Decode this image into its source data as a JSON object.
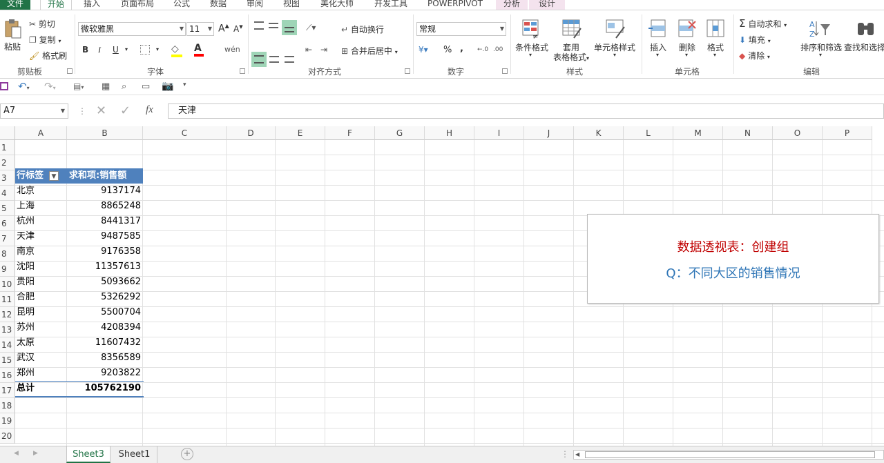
{
  "ribbon_tabs": [
    "文件",
    "开始",
    "插入",
    "页面布局",
    "公式",
    "数据",
    "审阅",
    "视图",
    "美化大师",
    "开发工具",
    "POWERPIVOT",
    "分析",
    "设计"
  ],
  "clipboard": {
    "paste": "粘贴",
    "cut": "剪切",
    "copy": "复制",
    "format_painter": "格式刷",
    "group": "剪贴板"
  },
  "font": {
    "name": "微软雅黑",
    "size": "11",
    "bold": "B",
    "italic": "I",
    "underline": "U",
    "group": "字体"
  },
  "alignment": {
    "wrap": "自动换行",
    "merge": "合并后居中",
    "group": "对齐方式"
  },
  "number": {
    "format": "常规",
    "percent": "%",
    "comma": ",",
    "group": "数字"
  },
  "styles": {
    "conditional": "条件格式",
    "table_format_1": "套用",
    "table_format_2": "表格格式",
    "cell_styles": "单元格样式",
    "group": "样式"
  },
  "cells": {
    "insert": "插入",
    "delete": "删除",
    "format": "格式",
    "group": "单元格"
  },
  "editing": {
    "autosum": "自动求和",
    "fill": "填充",
    "clear": "清除",
    "sort": "排序和筛选",
    "find": "查找和选择",
    "group": "编辑"
  },
  "formula_bar": {
    "name_box": "A7",
    "fx": "fx",
    "content": "天津"
  },
  "columns": [
    "A",
    "B",
    "C",
    "D",
    "E",
    "F",
    "G",
    "H",
    "I",
    "J",
    "K",
    "L",
    "M",
    "N",
    "O",
    "P"
  ],
  "rows": [
    "1",
    "2",
    "3",
    "4",
    "5",
    "6",
    "7",
    "8",
    "9",
    "10",
    "11",
    "12",
    "13",
    "14",
    "15",
    "16",
    "17",
    "18",
    "19",
    "20"
  ],
  "pivot": {
    "header_label": "行标签",
    "header_value": "求和项:销售额",
    "rows": [
      {
        "label": "北京",
        "value": "9137174"
      },
      {
        "label": "上海",
        "value": "8865248"
      },
      {
        "label": "杭州",
        "value": "8441317"
      },
      {
        "label": "天津",
        "value": "9487585"
      },
      {
        "label": "南京",
        "value": "9176358"
      },
      {
        "label": "沈阳",
        "value": "11357613"
      },
      {
        "label": "贵阳",
        "value": "5093662"
      },
      {
        "label": "合肥",
        "value": "5326292"
      },
      {
        "label": "昆明",
        "value": "5500704"
      },
      {
        "label": "苏州",
        "value": "4208394"
      },
      {
        "label": "太原",
        "value": "11607432"
      },
      {
        "label": "武汉",
        "value": "8356589"
      },
      {
        "label": "郑州",
        "value": "9203822"
      }
    ],
    "total_label": "总计",
    "total_value": "105762190"
  },
  "note": {
    "line1": "数据透视表：创建组",
    "line2": "Q：不同大区的销售情况",
    "line1_color": "#c00000",
    "line2_color": "#2e75b6"
  },
  "sheets": [
    "Sheet3",
    "Sheet1"
  ],
  "colors": {
    "accent": "#217346",
    "pivot_header": "#4f81bd",
    "highlight": "#9fd5b7"
  }
}
